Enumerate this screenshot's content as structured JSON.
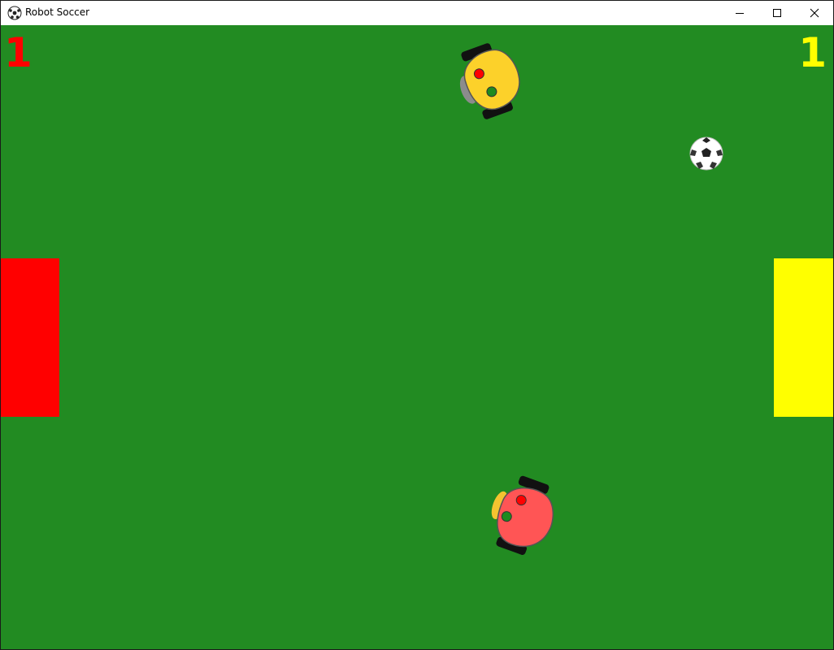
{
  "window": {
    "title": "Robot Soccer",
    "app_icon": "soccer-ball-icon",
    "controls": [
      "minimize-icon",
      "maximize-icon",
      "close-icon"
    ]
  },
  "scoreboard": {
    "red_score": "1",
    "yellow_score": "1",
    "red_color": "#ff0000",
    "yellow_color": "#ffff00"
  },
  "field": {
    "color": "#228b22"
  },
  "goals": {
    "left_color": "#ff0000",
    "right_color": "#ffff00"
  },
  "robots": {
    "yellow": {
      "body_color": "#fcd12a",
      "bumper_color": "#808080",
      "dot1": "#ff0000",
      "dot2": "#1f8a1f"
    },
    "red": {
      "body_color": "#ff5555",
      "bumper_color": "#f4c430",
      "dot1": "#ff0000",
      "dot2": "#1f8a1f"
    }
  }
}
